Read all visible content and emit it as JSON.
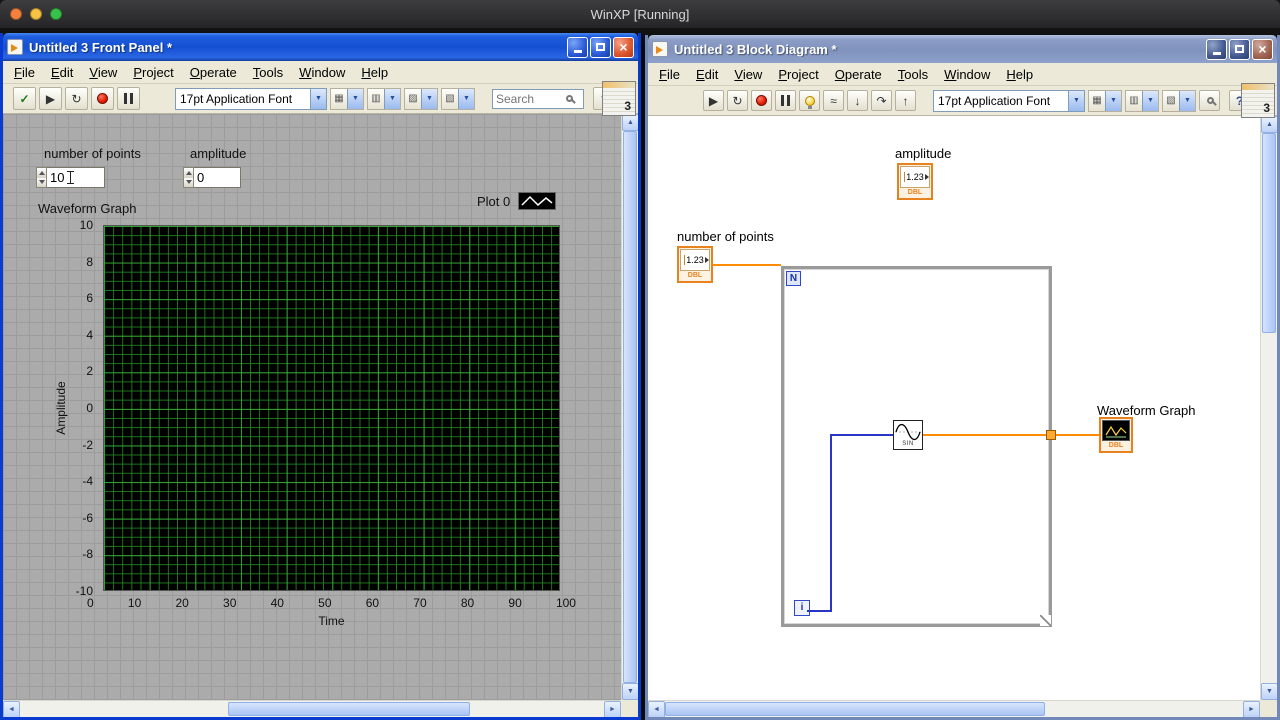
{
  "vm": {
    "title": "WinXP [Running]"
  },
  "colors": {
    "titlebar_active": "#1450d2",
    "titlebar_inactive": "#8598c4",
    "wire_double": "#ff8b00",
    "wire_integer": "#2836c8",
    "terminal_orange": "#e8821e",
    "plot_background": "#000000",
    "plot_grid_green": "#1e7a1e",
    "xp_chrome": "#ece9d8"
  },
  "icons": {
    "close": "×",
    "check": "✓",
    "run": "▶",
    "run_continuous": "↻",
    "dropdown": "▼",
    "align_objects": "▦",
    "distribute_objects": "▥",
    "resize_objects": "▨",
    "reorder_objects": "▧",
    "help": "?",
    "retain_wires": "≈",
    "step_into": "↓",
    "step_over": "↷",
    "step_out": "↑",
    "scroll_up": "▲",
    "scroll_down": "▼",
    "scroll_left": "◄",
    "scroll_right": "►"
  },
  "front_panel": {
    "title": "Untitled 3 Front Panel *",
    "menu": [
      "File",
      "Edit",
      "View",
      "Project",
      "Operate",
      "Tools",
      "Window",
      "Help"
    ],
    "toolbar": {
      "font_selector": "17pt Application Font",
      "search_placeholder": "Search",
      "vi_badge": "3"
    },
    "controls": {
      "points_label": "number of points",
      "points_value": "10",
      "amplitude_label": "amplitude",
      "amplitude_value": "0"
    },
    "graph": {
      "label": "Waveform Graph",
      "legend_label": "Plot 0",
      "y_axis_label": "Amplitude",
      "x_axis_label": "Time",
      "y_ticks": [
        "10",
        "8",
        "6",
        "4",
        "2",
        "0",
        "-2",
        "-4",
        "-6",
        "-8",
        "-10"
      ],
      "x_ticks": [
        "0",
        "10",
        "20",
        "30",
        "40",
        "50",
        "60",
        "70",
        "80",
        "90",
        "100"
      ],
      "y_range": [
        -10,
        10
      ],
      "x_range": [
        0,
        100
      ]
    }
  },
  "block_diagram": {
    "title": "Untitled 3 Block Diagram *",
    "menu": [
      "File",
      "Edit",
      "View",
      "Project",
      "Operate",
      "Tools",
      "Window",
      "Help"
    ],
    "toolbar": {
      "font_selector": "17pt Application Font",
      "vi_badge": "3"
    },
    "diagram": {
      "amplitude_label": "amplitude",
      "points_label": "number of points",
      "graph_label": "Waveform Graph",
      "numeric_terminal_value": "1.23",
      "terminal_type": "DBL",
      "loop_count_label": "N",
      "loop_iteration_label": "i",
      "sine_label": "SIN"
    }
  }
}
